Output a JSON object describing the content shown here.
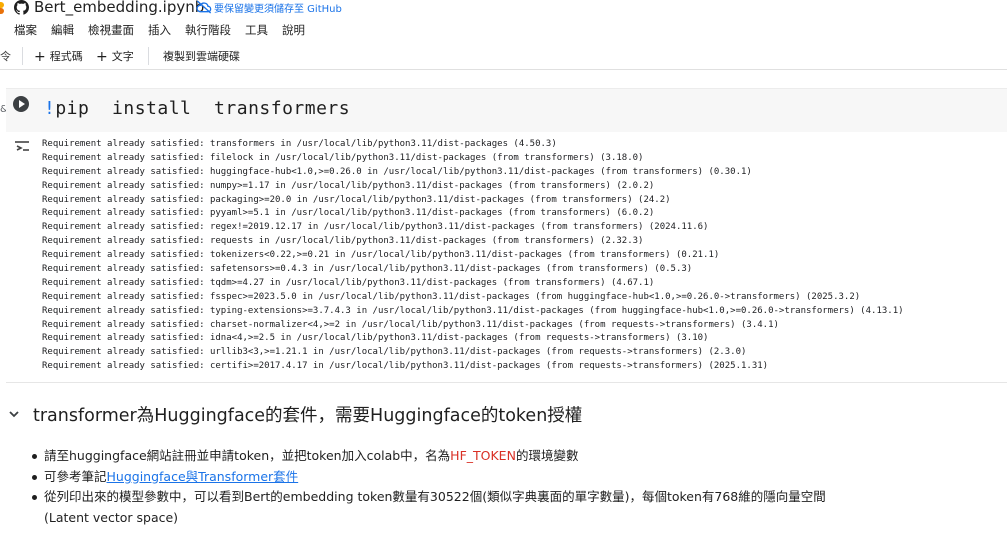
{
  "header": {
    "title": "Bert_embedding.ipynb",
    "save_notice": "要保留變更須儲存至 GitHub"
  },
  "menu": [
    "檔案",
    "編輯",
    "檢視畫面",
    "插入",
    "執行階段",
    "工具",
    "說明"
  ],
  "toolbar": {
    "cut_label": "令",
    "add_code": "程式碼",
    "add_text": "文字",
    "copy_to_drive": "複製到雲端硬碟"
  },
  "code_cell": {
    "side_label": "&",
    "bang": "!",
    "code": "pip  install  transformers"
  },
  "output_lines": [
    "Requirement already satisfied: transformers in /usr/local/lib/python3.11/dist-packages (4.50.3)",
    "Requirement already satisfied: filelock in /usr/local/lib/python3.11/dist-packages (from transformers) (3.18.0)",
    "Requirement already satisfied: huggingface-hub<1.0,>=0.26.0 in /usr/local/lib/python3.11/dist-packages (from transformers) (0.30.1)",
    "Requirement already satisfied: numpy>=1.17 in /usr/local/lib/python3.11/dist-packages (from transformers) (2.0.2)",
    "Requirement already satisfied: packaging>=20.0 in /usr/local/lib/python3.11/dist-packages (from transformers) (24.2)",
    "Requirement already satisfied: pyyaml>=5.1 in /usr/local/lib/python3.11/dist-packages (from transformers) (6.0.2)",
    "Requirement already satisfied: regex!=2019.12.17 in /usr/local/lib/python3.11/dist-packages (from transformers) (2024.11.6)",
    "Requirement already satisfied: requests in /usr/local/lib/python3.11/dist-packages (from transformers) (2.32.3)",
    "Requirement already satisfied: tokenizers<0.22,>=0.21 in /usr/local/lib/python3.11/dist-packages (from transformers) (0.21.1)",
    "Requirement already satisfied: safetensors>=0.4.3 in /usr/local/lib/python3.11/dist-packages (from transformers) (0.5.3)",
    "Requirement already satisfied: tqdm>=4.27 in /usr/local/lib/python3.11/dist-packages (from transformers) (4.67.1)",
    "Requirement already satisfied: fsspec>=2023.5.0 in /usr/local/lib/python3.11/dist-packages (from huggingface-hub<1.0,>=0.26.0->transformers) (2025.3.2)",
    "Requirement already satisfied: typing-extensions>=3.7.4.3 in /usr/local/lib/python3.11/dist-packages (from huggingface-hub<1.0,>=0.26.0->transformers) (4.13.1)",
    "Requirement already satisfied: charset-normalizer<4,>=2 in /usr/local/lib/python3.11/dist-packages (from requests->transformers) (3.4.1)",
    "Requirement already satisfied: idna<4,>=2.5 in /usr/local/lib/python3.11/dist-packages (from requests->transformers) (3.10)",
    "Requirement already satisfied: urllib3<3,>=1.21.1 in /usr/local/lib/python3.11/dist-packages (from requests->transformers) (2.3.0)",
    "Requirement already satisfied: certifi>=2017.4.17 in /usr/local/lib/python3.11/dist-packages (from requests->transformers) (2025.1.31)"
  ],
  "markdown": {
    "heading": "transformer為Huggingface的套件，需要Huggingface的token授權",
    "bullet1_pre": "請至huggingface網站註冊並申請token，並把token加入colab中，名為",
    "bullet1_red": "HF_TOKEN",
    "bullet1_post": "的環境變數",
    "bullet2_pre": "可參考筆記",
    "bullet2_link": "Huggingface與Transformer套件",
    "bullet3": "從列印出來的模型參數中，可以看到Bert的embedding token數量有30522個(類似字典裏面的單字數量)，每個token有768維的隱向量空間(Latent vector space)"
  },
  "colors": {
    "accent": "#1a73e8",
    "red_text": "#d93025",
    "cell_bg": "#f7f7f7"
  }
}
